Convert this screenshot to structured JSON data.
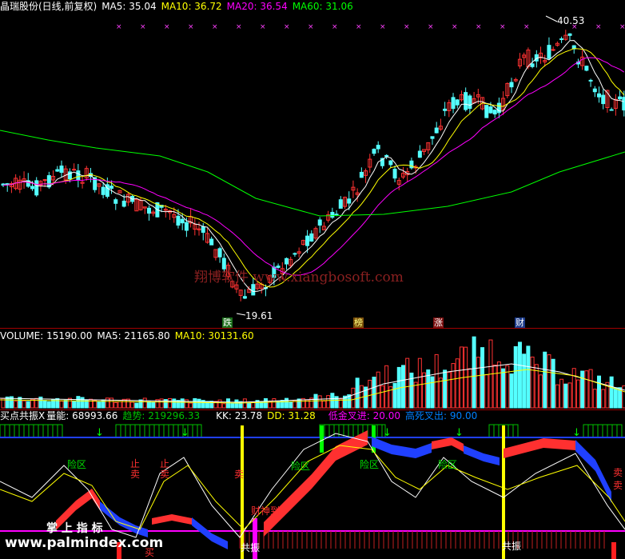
{
  "price_header": {
    "title": "晶瑞股份(日线,前复权)",
    "ma5": "MA5: 35.04",
    "ma10": "MA10: 36.72",
    "ma20": "MA20: 36.54",
    "ma60": "MA60: 31.06"
  },
  "price_annotations": {
    "high_label": "40.53",
    "low_label": "19.61",
    "watermark": "翔博软件 www.xiangbosoft.com"
  },
  "price_signals": {
    "die": "跌",
    "bang": "榜",
    "zhang": "涨",
    "cai": "财"
  },
  "volume_header": {
    "volume": "VOLUME: 15190.00",
    "ma5": "MA5: 21165.80",
    "ma10": "MA10: 30131.60"
  },
  "indicator_header": {
    "name": "买点共振X",
    "liangneng": "量能: 68993.66",
    "qushi": "趋势: 219296.33",
    "kk": "KK: 23.78",
    "dd": "DD: 31.28",
    "dijin": "低金叉进: 20.00",
    "gaosi": "高死叉出: 90.00"
  },
  "indicator_labels": {
    "xianqu": "险区",
    "zhimai": "止卖",
    "mai": "卖",
    "caishen": "财神到",
    "gongzhen": "共振",
    "zhangshang": "掌 上 指 标",
    "site": "www.palmindex.com",
    "mairu": "买"
  },
  "colors": {
    "up": "#ff3232",
    "down": "#54ffff",
    "ma5": "#ffffff",
    "ma10": "#ffff00",
    "ma20": "#ff00ff",
    "ma60": "#00ff00",
    "divider": "#a00000"
  }
}
